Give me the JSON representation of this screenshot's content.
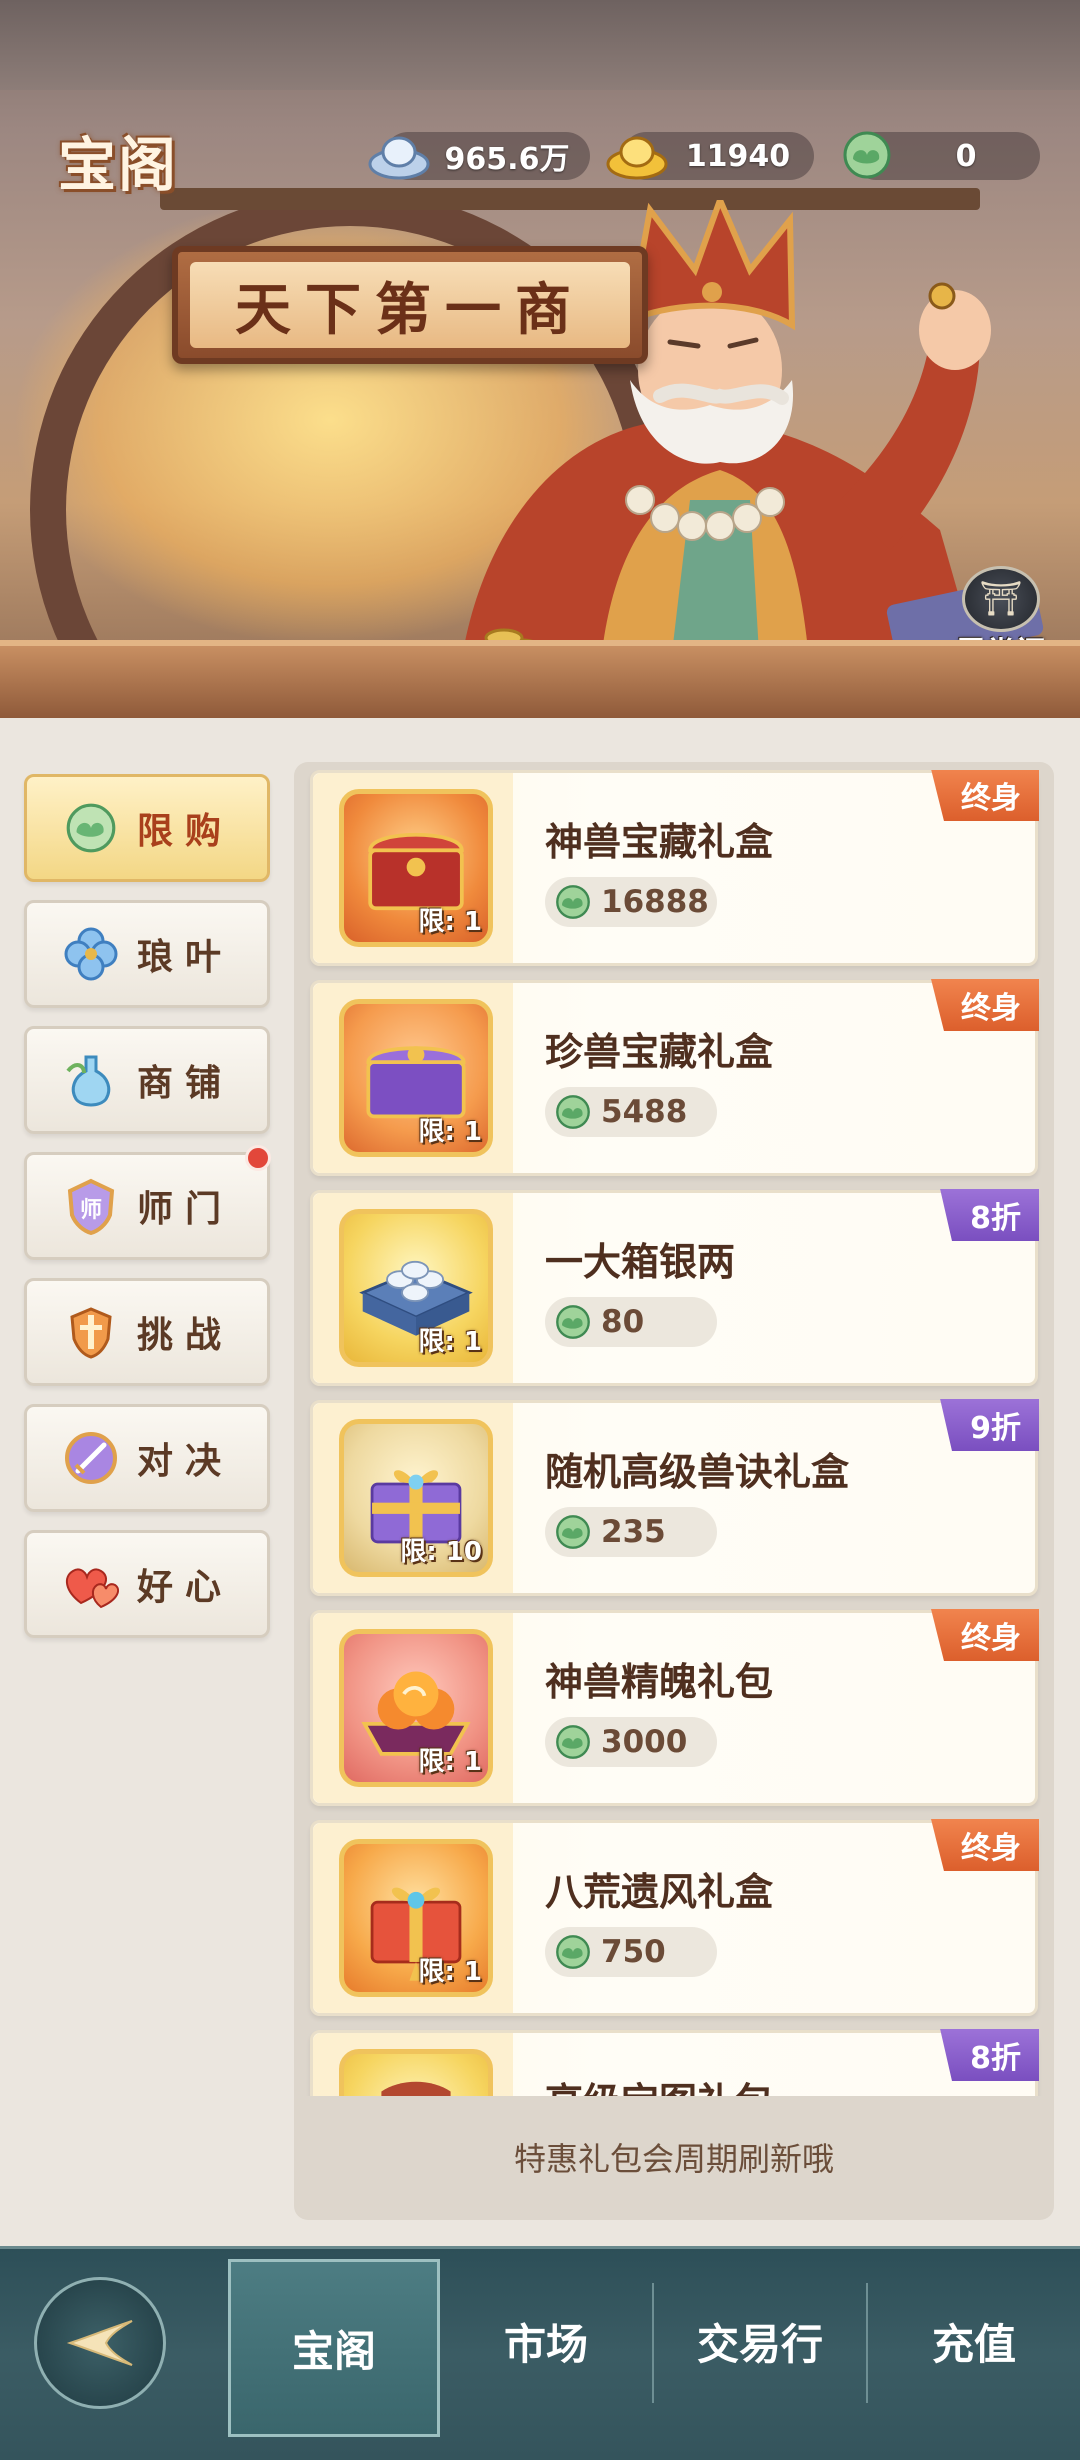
{
  "header": {
    "title": "宝阁",
    "currencies": [
      {
        "icon": "silver-ingot-icon",
        "value": "965.6万"
      },
      {
        "icon": "gold-ingot-icon",
        "value": "11940"
      },
      {
        "icon": "jade-cloud-icon",
        "value": "0"
      }
    ],
    "sign_text": "天下第一商",
    "gallery_label": "霓裳阁"
  },
  "sidebar": {
    "items": [
      {
        "label": "限购",
        "icon": "jade-cloud-icon",
        "active": true
      },
      {
        "label": "琅叶",
        "icon": "clover-icon",
        "active": false
      },
      {
        "label": "商铺",
        "icon": "potion-bottle-icon",
        "active": false
      },
      {
        "label": "师门",
        "icon": "sect-badge-icon",
        "active": false,
        "badge": true,
        "badge_text": "师"
      },
      {
        "label": "挑战",
        "icon": "sword-shield-icon",
        "active": false
      },
      {
        "label": "对决",
        "icon": "duel-sword-icon",
        "active": false
      },
      {
        "label": "好心",
        "icon": "hearts-icon",
        "active": false
      }
    ]
  },
  "products": [
    {
      "name": "神兽宝藏礼盒",
      "price": "16888",
      "limit": "限: 1",
      "tag": "终身",
      "tag_type": "lifetime",
      "icon": "red-treasure-chest-icon"
    },
    {
      "name": "珍兽宝藏礼盒",
      "price": "5488",
      "limit": "限: 1",
      "tag": "终身",
      "tag_type": "lifetime",
      "icon": "purple-treasure-chest-icon"
    },
    {
      "name": "一大箱银两",
      "price": "80",
      "limit": "限: 1",
      "tag": "8折",
      "tag_type": "discount",
      "icon": "silver-box-icon"
    },
    {
      "name": "随机高级兽诀礼盒",
      "price": "235",
      "limit": "限: 10",
      "tag": "9折",
      "tag_type": "discount",
      "icon": "purple-gift-box-icon"
    },
    {
      "name": "神兽精魄礼包",
      "price": "3000",
      "limit": "限: 1",
      "tag": "终身",
      "tag_type": "lifetime",
      "icon": "spirit-essence-icon"
    },
    {
      "name": "八荒遗风礼盒",
      "price": "750",
      "limit": "限: 1",
      "tag": "终身",
      "tag_type": "lifetime",
      "icon": "red-gift-box-icon"
    },
    {
      "name": "高级宝图礼包",
      "price": "",
      "limit": "",
      "tag": "8折",
      "tag_type": "discount",
      "icon": "treasure-map-icon"
    }
  ],
  "footer_note": "特惠礼包会周期刷新哦",
  "bottom_nav": {
    "back_icon": "back-arrow-icon",
    "tabs": [
      {
        "label": "宝阁",
        "active": true
      },
      {
        "label": "市场",
        "active": false
      },
      {
        "label": "交易行",
        "active": false
      },
      {
        "label": "充值",
        "active": false
      }
    ]
  },
  "colors": {
    "accent_active": "#a9401c",
    "tag_lifetime": "#dc5f2c",
    "tag_discount": "#7a4fc0",
    "nav_background": "#3b5c64"
  }
}
